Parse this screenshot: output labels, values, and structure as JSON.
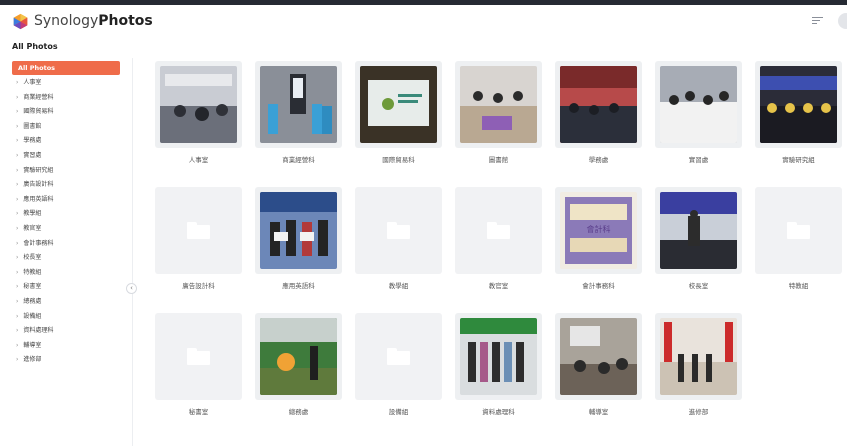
{
  "app": {
    "brand_prefix": "Synology",
    "brand_suffix": "Photos",
    "logo_icon": "synology-photos-logo",
    "sort_icon": "sort-icon"
  },
  "page": {
    "section_title": "All Photos"
  },
  "sidebar": {
    "active_label": "All Photos",
    "accent": "#ef6c4a",
    "items": [
      "人事室",
      "商業經營科",
      "國際貿易科",
      "圖書館",
      "學務處",
      "實習處",
      "實驗研究組",
      "廣告設計科",
      "應用英語科",
      "教學組",
      "教官室",
      "會計事務科",
      "校長室",
      "特教組",
      "秘書室",
      "總務處",
      "設備組",
      "資料處理科",
      "輔導室",
      "進修部"
    ]
  },
  "albums": [
    {
      "label": "人事室",
      "type": "photo"
    },
    {
      "label": "商業經營科",
      "type": "photo"
    },
    {
      "label": "國際貿易科",
      "type": "photo"
    },
    {
      "label": "圖書館",
      "type": "photo"
    },
    {
      "label": "學務處",
      "type": "photo"
    },
    {
      "label": "實習處",
      "type": "photo"
    },
    {
      "label": "實驗研究組",
      "type": "photo"
    },
    {
      "label": "廣告設計科",
      "type": "folder"
    },
    {
      "label": "應用英語科",
      "type": "photo"
    },
    {
      "label": "教學組",
      "type": "folder"
    },
    {
      "label": "教官室",
      "type": "folder"
    },
    {
      "label": "會計事務科",
      "type": "photo",
      "caption": "會計科"
    },
    {
      "label": "校長室",
      "type": "photo"
    },
    {
      "label": "特教組",
      "type": "folder"
    },
    {
      "label": "秘書室",
      "type": "folder"
    },
    {
      "label": "總務處",
      "type": "photo"
    },
    {
      "label": "設備組",
      "type": "folder"
    },
    {
      "label": "資料處理科",
      "type": "photo"
    },
    {
      "label": "輔導室",
      "type": "photo"
    },
    {
      "label": "進修部",
      "type": "photo"
    }
  ]
}
